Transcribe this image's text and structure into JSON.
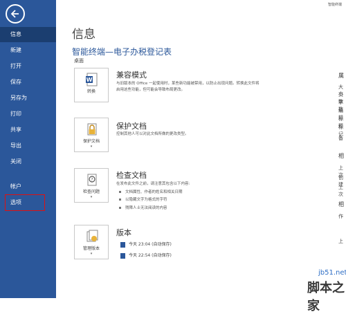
{
  "sidebar": {
    "items": [
      {
        "label": "信息"
      },
      {
        "label": "新建"
      },
      {
        "label": "打开"
      },
      {
        "label": "保存"
      },
      {
        "label": "另存为"
      },
      {
        "label": "打印"
      },
      {
        "label": "共享"
      },
      {
        "label": "导出"
      },
      {
        "label": "关闭"
      },
      {
        "label": "帐户"
      },
      {
        "label": "选项"
      }
    ]
  },
  "header": {
    "window_title_fragment": "智能终端",
    "page_title": "信息",
    "doc_title": "智能终端—电子办税登记表",
    "doc_path": "桌面"
  },
  "sections": {
    "compat": {
      "tile_label": "转换",
      "heading": "兼容模式",
      "desc_line1": "与旧版本的 Office 一起使用时，某些新功能被禁用，以防止出现问题。转换此文件将",
      "desc_line2": "启用这些功能，但可能会导致布局更改。"
    },
    "protect": {
      "tile_label": "保护文档",
      "heading": "保护文档",
      "desc": "控制其他人可以对此文档所做的更改类型。"
    },
    "inspect": {
      "tile_label": "检查问题",
      "heading": "检查文档",
      "desc": "在发布此文件之前，请注意其包含以下内容:",
      "bullets": [
        "文档属性、作者的姓名和相关日期",
        "以隐藏文字为格式的字符",
        "残障人士无法阅读的内容"
      ]
    },
    "versions": {
      "tile_label": "管理版本",
      "heading": "版本",
      "entries": [
        "今天 23:04 (自动保存)",
        "今天 22:54 (自动保存)"
      ]
    }
  },
  "right_panel": {
    "heading1": "属",
    "lines": [
      "大小",
      "页数",
      "字数",
      "编辑",
      "标题",
      "标记",
      "备"
    ],
    "heading2": "相",
    "lines2": [
      "上次",
      "创建",
      "上次"
    ],
    "heading3": "相",
    "lines3": [
      "作",
      "上"
    ]
  },
  "watermark": {
    "line1": "jb51.net",
    "line2": "脚本之家"
  },
  "colors": {
    "sidebar_bg": "#2b579a",
    "sidebar_active": "#1b3e70",
    "accent": "#2b579a",
    "options_highlight": "#e01010"
  }
}
